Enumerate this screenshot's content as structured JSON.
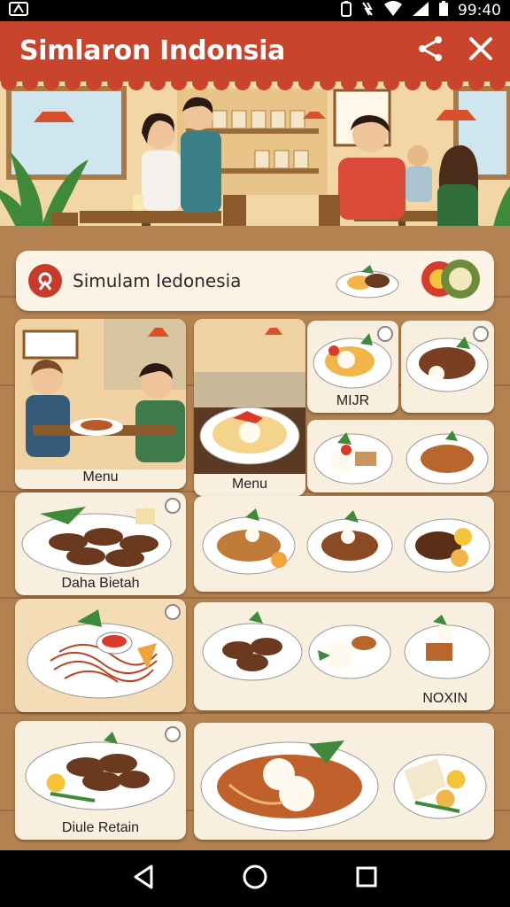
{
  "status_bar": {
    "time": "99:40"
  },
  "app_bar": {
    "title": "Simlaron Indonsia"
  },
  "search": {
    "text": "Simulam Iedonesia"
  },
  "tiles": {
    "menu_left": "Menu",
    "menu_mid": "Menu",
    "mijr": "MIJR",
    "daha_bietah": "Daha Bietah",
    "noxin": "NOXIN",
    "diule_retain": "Diule Retain"
  },
  "colors": {
    "appbar": "#c9442c",
    "panel": "#f8efdf",
    "wood": "#b98852"
  }
}
